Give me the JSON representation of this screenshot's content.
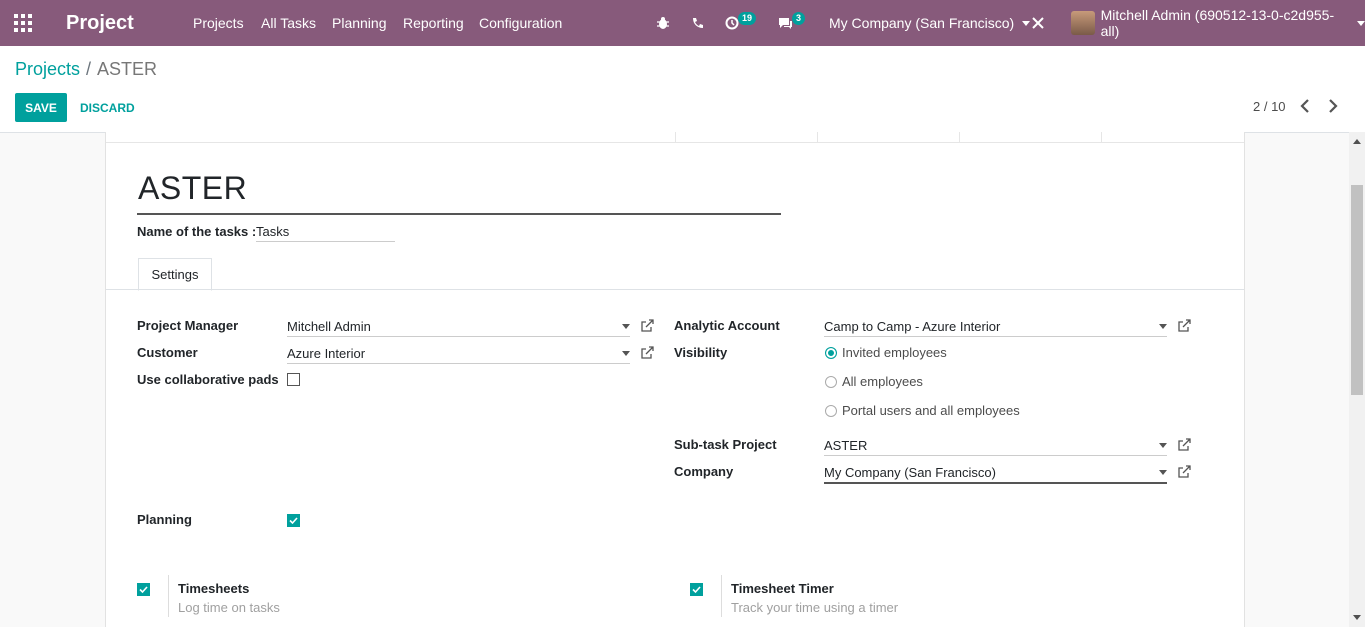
{
  "navbar": {
    "brand": "Project",
    "menu": [
      "Projects",
      "All Tasks",
      "Planning",
      "Reporting",
      "Configuration"
    ],
    "activity_count": "19",
    "messages_count": "3",
    "company": "My Company (San Francisco)",
    "user": "Mitchell Admin (690512-13-0-c2d955-all)"
  },
  "breadcrumb": {
    "parent": "Projects",
    "separator": "/",
    "current": "ASTER"
  },
  "buttons": {
    "save": "SAVE",
    "discard": "DISCARD"
  },
  "pager": {
    "text": "2 / 10"
  },
  "form": {
    "title": "ASTER",
    "tasks_label": "Name of the tasks :",
    "tasks_value": "Tasks",
    "tab": "Settings",
    "left": {
      "project_manager_label": "Project Manager",
      "project_manager_value": "Mitchell Admin",
      "customer_label": "Customer",
      "customer_value": "Azure Interior",
      "collab_label": "Use collaborative pads",
      "collab_checked": false
    },
    "right": {
      "analytic_label": "Analytic Account",
      "analytic_value": "Camp to Camp - Azure Interior",
      "visibility_label": "Visibility",
      "visibility_options": [
        "Invited employees",
        "All employees",
        "Portal users and all employees"
      ],
      "visibility_selected": 0,
      "subtask_label": "Sub-task Project",
      "subtask_value": "ASTER",
      "company_label": "Company",
      "company_value": "My Company (San Francisco)"
    },
    "planning_label": "Planning",
    "planning_checked": true,
    "timesheets": {
      "title": "Timesheets",
      "help": "Log time on tasks",
      "checked": true
    },
    "timer": {
      "title": "Timesheet Timer",
      "help": "Track your time using a timer",
      "checked": true
    }
  },
  "colors": {
    "navbar": "#875a7b",
    "accent": "#00a09d"
  }
}
